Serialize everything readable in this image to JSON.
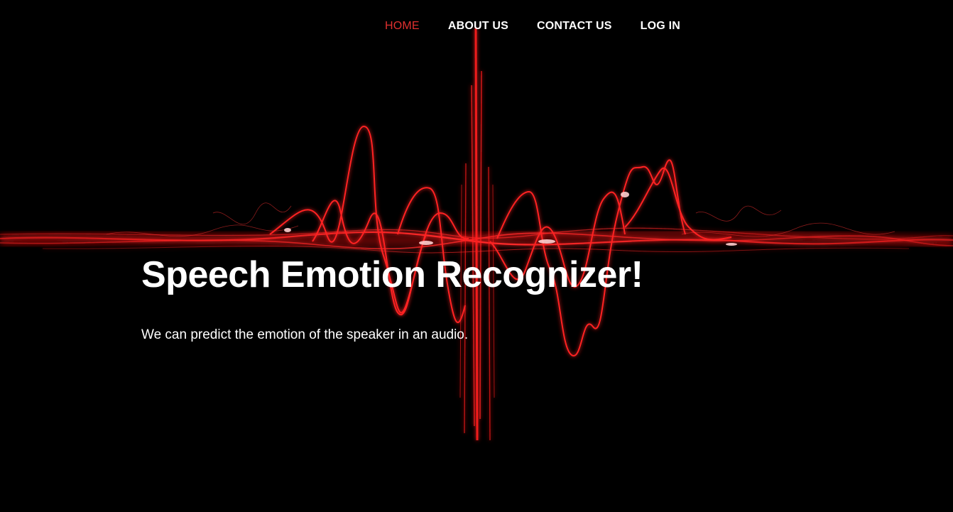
{
  "nav": {
    "items": [
      {
        "label": "HOME",
        "active": true
      },
      {
        "label": "ABOUT US",
        "active": false
      },
      {
        "label": "CONTACT US",
        "active": false
      },
      {
        "label": "LOG IN",
        "active": false
      }
    ]
  },
  "hero": {
    "title": "Speech Emotion Recognizer!",
    "subtitle": "We can predict the emotion of the speaker in an audio."
  },
  "colors": {
    "background": "#000000",
    "accent": "#e0302f",
    "wave": "#ff1a1a",
    "text": "#ffffff"
  },
  "background_image": {
    "icon": "red-sound-waveform"
  }
}
